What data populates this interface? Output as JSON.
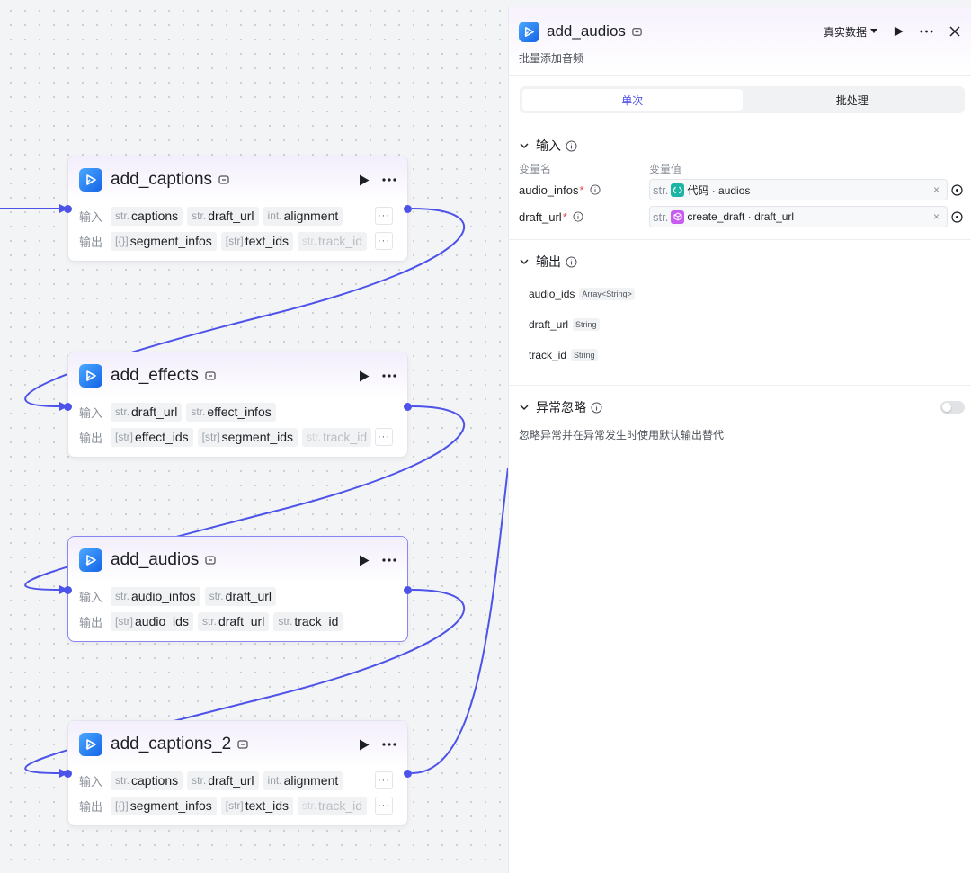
{
  "nodes": [
    {
      "title": "add_captions",
      "input_label": "输入",
      "output_label": "输出",
      "inputs": [
        {
          "type": "str.",
          "name": "captions"
        },
        {
          "type": "str.",
          "name": "draft_url"
        },
        {
          "type": "int.",
          "name": "alignment"
        }
      ],
      "outputs": [
        {
          "type": "[{}]",
          "name": "segment_infos"
        },
        {
          "type": "[str]",
          "name": "text_ids"
        },
        {
          "type": "str.",
          "name": "track_id"
        }
      ]
    },
    {
      "title": "add_effects",
      "input_label": "输入",
      "output_label": "输出",
      "inputs": [
        {
          "type": "str.",
          "name": "draft_url"
        },
        {
          "type": "str.",
          "name": "effect_infos"
        }
      ],
      "outputs": [
        {
          "type": "[str]",
          "name": "effect_ids"
        },
        {
          "type": "[str]",
          "name": "segment_ids"
        },
        {
          "type": "str.",
          "name": "track_id"
        }
      ]
    },
    {
      "title": "add_audios",
      "input_label": "输入",
      "output_label": "输出",
      "inputs": [
        {
          "type": "str.",
          "name": "audio_infos"
        },
        {
          "type": "str.",
          "name": "draft_url"
        }
      ],
      "outputs": [
        {
          "type": "[str]",
          "name": "audio_ids"
        },
        {
          "type": "str.",
          "name": "draft_url"
        },
        {
          "type": "str.",
          "name": "track_id"
        }
      ]
    },
    {
      "title": "add_captions_2",
      "input_label": "输入",
      "output_label": "输出",
      "inputs": [
        {
          "type": "str.",
          "name": "captions"
        },
        {
          "type": "str.",
          "name": "draft_url"
        },
        {
          "type": "int.",
          "name": "alignment"
        }
      ],
      "outputs": [
        {
          "type": "[{}]",
          "name": "segment_infos"
        },
        {
          "type": "[str]",
          "name": "text_ids"
        },
        {
          "type": "str.",
          "name": "track_id"
        }
      ]
    }
  ],
  "panel": {
    "title": "add_audios",
    "data_mode": "真实数据",
    "description": "批量添加音频",
    "tabs": [
      "单次",
      "批处理"
    ],
    "active_tab": 0,
    "input_section": {
      "title": "输入",
      "col_name": "变量名",
      "col_value": "变量值",
      "rows": [
        {
          "name": "audio_infos",
          "type": "str.",
          "ref_node": "代码",
          "ref_var": "audios",
          "ref_color": "#1cb5a3"
        },
        {
          "name": "draft_url",
          "type": "str.",
          "ref_node": "create_draft",
          "ref_var": "draft_url",
          "ref_color": "#c95cf0"
        }
      ]
    },
    "output_section": {
      "title": "输出",
      "items": [
        {
          "name": "audio_ids",
          "type": "Array<String>"
        },
        {
          "name": "draft_url",
          "type": "String"
        },
        {
          "name": "track_id",
          "type": "String"
        }
      ]
    },
    "error_section": {
      "title": "异常忽略",
      "description": "忽略异常并在异常发生时使用默认输出替代",
      "enabled": false
    }
  },
  "colors": {
    "edge": "#4d53e8",
    "accent": "#4d53e8",
    "node_logo": "#1f7af0"
  }
}
